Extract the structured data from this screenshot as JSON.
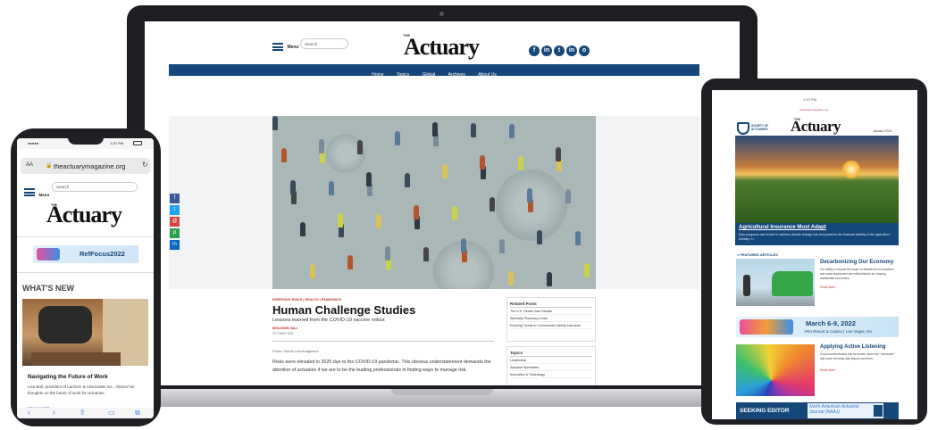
{
  "laptop": {
    "menu_label": "Menu",
    "search_label": "Search",
    "logo_small": "THE",
    "logo": "Actuary",
    "social": [
      "f",
      "in",
      "t",
      "in",
      "o"
    ],
    "social_names": [
      "facebook-icon",
      "instagram-icon",
      "twitter-icon",
      "linkedin-icon",
      "rss-icon"
    ],
    "nav": [
      "Home",
      "Topics",
      "Global",
      "Archives",
      "About Us"
    ],
    "share": [
      {
        "glyph": "f",
        "color": "#3b5998",
        "name": "facebook-share-icon"
      },
      {
        "glyph": "t",
        "color": "#1da1f2",
        "name": "twitter-share-icon"
      },
      {
        "glyph": "@",
        "color": "#d6453d",
        "name": "email-share-icon"
      },
      {
        "glyph": "p",
        "color": "#2f9e4f",
        "name": "print-share-icon"
      },
      {
        "glyph": "in",
        "color": "#0a66c2",
        "name": "linkedin-share-icon"
      }
    ],
    "article": {
      "tags": "EMERGING RISKS | HEALTH | PANDEMICS",
      "title": "Human Challenge Studies",
      "subtitle": "Lessons learned from the COVID-19 vaccine rollout",
      "author": "BENJAMIN HALL",
      "date": "OCTOBER 2021",
      "photo_credit": "Photo: iStock.com/imaginima",
      "body": "Risks were elevated in 2020 due to the COVID-19 pandemic. This obvious understatement demands the attention of actuaries if we are to be the leading professionals in finding ways to manage risk."
    },
    "related": {
      "title": "Related Posts",
      "items": [
        "The U.S. Health Care Debate",
        "Specialty Pharmacy Costs",
        "Evolving Trends in Commercial Liability Insurance"
      ]
    },
    "topics": {
      "title": "Topics",
      "items": [
        "Leadership",
        "Actuarial Specialties",
        "Innovation & Technology"
      ]
    }
  },
  "phone": {
    "status_left": "●●●●●",
    "status_time": "1:20 PM",
    "url_aa": "AA",
    "url": "theactuarymagazine.org",
    "menu_label": "Menu",
    "search_label": "Search",
    "logo_small": "THE",
    "logo": "Actuary",
    "banner": "RefFocus2022",
    "section": "WHAT'S NEW",
    "article_title": "Navigating the Future of Work",
    "article_text": "Lisa Bull, president of Lachner & Associates Inc., shares her thoughts on the future of work for actuaries.",
    "read_more": "READ MORE"
  },
  "tablet": {
    "status_time": "1:20 PM",
    "top_link": "theactuarymagazine.org",
    "soa_label": "SOCIETY OF ACTUARIES",
    "logo_small": "THE",
    "logo": "Actuary",
    "issue": "January 2022",
    "feature_title": "Agricultural Insurance Must Adapt",
    "feature_text": "How programs can evolve to address climate change risk and preserve the financial stability of the agriculture industry >>",
    "featured_label": "< FEATURED ARTICLES",
    "a1_title": "Decarbonizing Our Economy",
    "a1_text": "Our ability to expand the scope of climate-tech innovations and scale deployment are critical factors for shaping sustainable economies.",
    "read_more": "Read More",
    "event_date": "March 6-9, 2022",
    "event_place": "ARA Resort & Casino | Las Vegas, NV",
    "a2_title": "Applying Active Listening",
    "a2_text": "Good communication can be broken down into \"receivable\" and some formulas that anyone can learn.",
    "seeking": "SEEKING EDITOR",
    "journal": "North American Actuarial Journal (NAAJ)"
  }
}
